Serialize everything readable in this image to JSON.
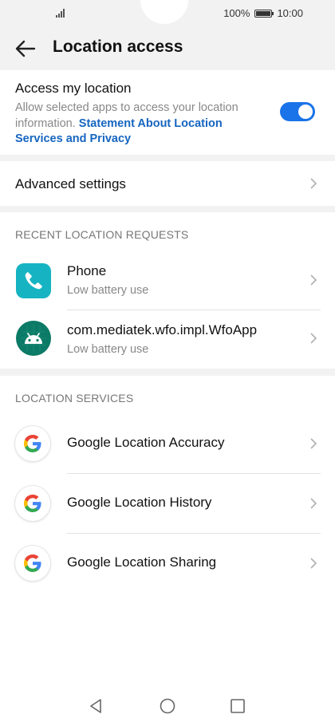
{
  "status": {
    "battery_percent": "100%",
    "time": "10:00",
    "battery_level": 1.0
  },
  "header": {
    "title": "Location access",
    "back_icon": "back-arrow-icon"
  },
  "access": {
    "title": "Access my location",
    "desc_plain": "Allow selected apps to access your location information.",
    "desc_link": "Statement About Location Services and Privacy",
    "toggle_on": true,
    "accent": "#1a73e8",
    "link_color": "#1565c0"
  },
  "advanced": {
    "label": "Advanced settings"
  },
  "recent": {
    "section_title": "RECENT LOCATION REQUESTS",
    "items": [
      {
        "title": "Phone",
        "subtitle": "Low battery use",
        "icon": "phone-app-icon"
      },
      {
        "title": "com.mediatek.wfo.impl.WfoApp",
        "subtitle": "Low battery use",
        "icon": "android-app-icon"
      }
    ]
  },
  "services": {
    "section_title": "LOCATION SERVICES",
    "items": [
      {
        "title": "Google Location Accuracy",
        "icon": "google-icon"
      },
      {
        "title": "Google Location History",
        "icon": "google-icon"
      },
      {
        "title": "Google Location Sharing",
        "icon": "google-icon"
      }
    ]
  },
  "navbar": {
    "icons": [
      "nav-back-icon",
      "nav-home-icon",
      "nav-recents-icon"
    ]
  }
}
